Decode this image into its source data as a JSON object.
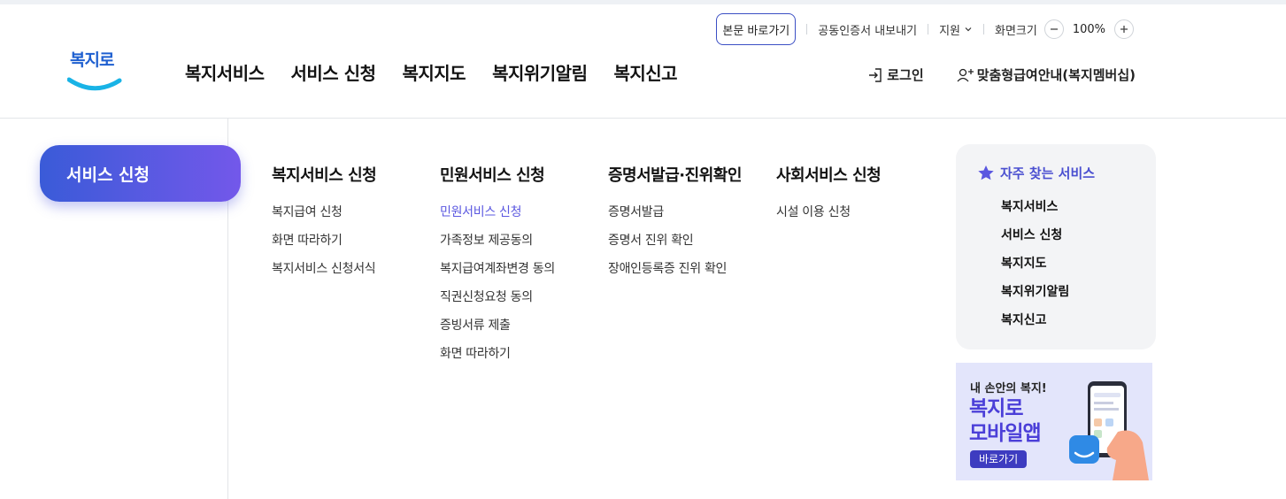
{
  "utility": {
    "skip_to_content": "본문 바로가기",
    "cert_export": "공동인증서 내보내기",
    "support": "지원",
    "screen_size": "화면크기",
    "zoom_level": "100%"
  },
  "logo": {
    "text": "복지로"
  },
  "gnb": {
    "items": [
      "복지서비스",
      "서비스 신청",
      "복지지도",
      "복지위기알림",
      "복지신고"
    ]
  },
  "member": {
    "login": "로그인",
    "membership": "맞춤형급여안내(복지멤버십)"
  },
  "menu": {
    "category": "서비스 신청",
    "columns": [
      {
        "title": "복지서비스 신청",
        "items": [
          "복지급여 신청",
          "화면 따라하기",
          "복지서비스 신청서식"
        ]
      },
      {
        "title": "민원서비스 신청",
        "items": [
          "민원서비스 신청",
          "가족정보 제공동의",
          "복지급여계좌변경 동의",
          "직권신청요청 동의",
          "증빙서류 제출",
          "화면 따라하기"
        ]
      },
      {
        "title": "증명서발급·진위확인",
        "items": [
          "증명서발급",
          "증명서 진위 확인",
          "장애인등록증 진위 확인"
        ]
      },
      {
        "title": "사회서비스 신청",
        "items": [
          "시설 이용 신청"
        ]
      }
    ]
  },
  "favorites": {
    "title": "자주 찾는 서비스",
    "items": [
      "복지서비스",
      "서비스 신청",
      "복지지도",
      "복지위기알림",
      "복지신고"
    ]
  },
  "banner": {
    "subtitle": "내 손안의 복지!",
    "title_line1": "복지로",
    "title_line2": "모바일앱",
    "button": "바로가기"
  },
  "colors": {
    "accent": "#5a57e0",
    "gradient_start": "#3a5bd8",
    "gradient_end": "#7358ea"
  }
}
